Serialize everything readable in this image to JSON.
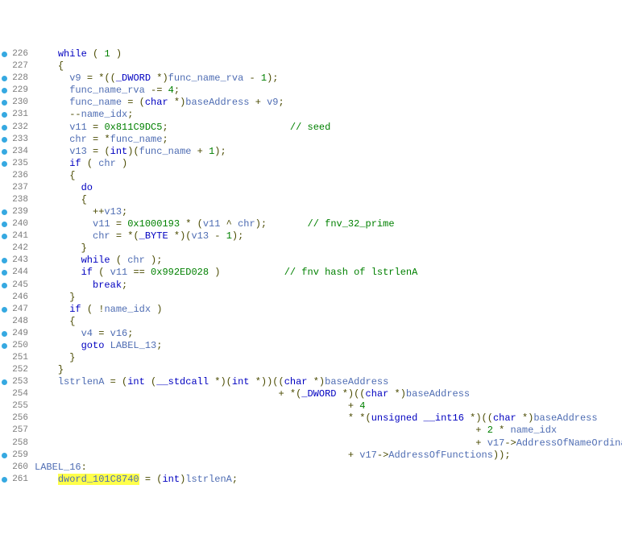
{
  "lines": [
    {
      "n": "226",
      "bp": true,
      "seg": [
        [
          "    ",
          0
        ],
        [
          "while",
          1
        ],
        [
          " ",
          0
        ],
        [
          "(",
          3
        ],
        [
          " ",
          0
        ],
        [
          "1",
          4
        ],
        [
          " ",
          0
        ],
        [
          ")",
          3
        ]
      ]
    },
    {
      "n": "227",
      "bp": false,
      "seg": [
        [
          "    ",
          0
        ],
        [
          "{",
          3
        ]
      ]
    },
    {
      "n": "228",
      "bp": true,
      "seg": [
        [
          "      ",
          0
        ],
        [
          "v9",
          2
        ],
        [
          " ",
          0
        ],
        [
          "=",
          3
        ],
        [
          " ",
          0
        ],
        [
          "*",
          3
        ],
        [
          "((",
          3
        ],
        [
          "_DWORD",
          1
        ],
        [
          " ",
          0
        ],
        [
          "*",
          3
        ],
        [
          ")",
          3
        ],
        [
          "func_name_rva",
          2
        ],
        [
          " ",
          0
        ],
        [
          "-",
          3
        ],
        [
          " ",
          0
        ],
        [
          "1",
          4
        ],
        [
          ");",
          3
        ]
      ]
    },
    {
      "n": "229",
      "bp": true,
      "seg": [
        [
          "      ",
          0
        ],
        [
          "func_name_rva",
          2
        ],
        [
          " ",
          0
        ],
        [
          "-=",
          3
        ],
        [
          " ",
          0
        ],
        [
          "4",
          4
        ],
        [
          ";",
          3
        ]
      ]
    },
    {
      "n": "230",
      "bp": true,
      "seg": [
        [
          "      ",
          0
        ],
        [
          "func_name",
          2
        ],
        [
          " ",
          0
        ],
        [
          "=",
          3
        ],
        [
          " ",
          0
        ],
        [
          "(",
          3
        ],
        [
          "char",
          1
        ],
        [
          " ",
          0
        ],
        [
          "*",
          3
        ],
        [
          ")",
          3
        ],
        [
          "baseAddress",
          2
        ],
        [
          " ",
          0
        ],
        [
          "+",
          3
        ],
        [
          " ",
          0
        ],
        [
          "v9",
          2
        ],
        [
          ";",
          3
        ]
      ]
    },
    {
      "n": "231",
      "bp": true,
      "seg": [
        [
          "      ",
          0
        ],
        [
          "--",
          3
        ],
        [
          "name_idx",
          2
        ],
        [
          ";",
          3
        ]
      ]
    },
    {
      "n": "232",
      "bp": true,
      "seg": [
        [
          "      ",
          0
        ],
        [
          "v11",
          2
        ],
        [
          " ",
          0
        ],
        [
          "=",
          3
        ],
        [
          " ",
          0
        ],
        [
          "0x811C9DC5",
          4
        ],
        [
          ";",
          3
        ],
        [
          "                     ",
          0
        ],
        [
          "// seed",
          5
        ]
      ]
    },
    {
      "n": "233",
      "bp": true,
      "seg": [
        [
          "      ",
          0
        ],
        [
          "chr",
          2
        ],
        [
          " ",
          0
        ],
        [
          "=",
          3
        ],
        [
          " ",
          0
        ],
        [
          "*",
          3
        ],
        [
          "func_name",
          2
        ],
        [
          ";",
          3
        ]
      ]
    },
    {
      "n": "234",
      "bp": true,
      "seg": [
        [
          "      ",
          0
        ],
        [
          "v13",
          2
        ],
        [
          " ",
          0
        ],
        [
          "=",
          3
        ],
        [
          " ",
          0
        ],
        [
          "(",
          3
        ],
        [
          "int",
          1
        ],
        [
          ")(",
          3
        ],
        [
          "func_name",
          2
        ],
        [
          " ",
          0
        ],
        [
          "+",
          3
        ],
        [
          " ",
          0
        ],
        [
          "1",
          4
        ],
        [
          ");",
          3
        ]
      ]
    },
    {
      "n": "235",
      "bp": true,
      "seg": [
        [
          "      ",
          0
        ],
        [
          "if",
          1
        ],
        [
          " ",
          0
        ],
        [
          "(",
          3
        ],
        [
          " ",
          0
        ],
        [
          "chr",
          2
        ],
        [
          " ",
          0
        ],
        [
          ")",
          3
        ]
      ]
    },
    {
      "n": "236",
      "bp": false,
      "seg": [
        [
          "      ",
          0
        ],
        [
          "{",
          3
        ]
      ]
    },
    {
      "n": "237",
      "bp": false,
      "seg": [
        [
          "        ",
          0
        ],
        [
          "do",
          1
        ]
      ]
    },
    {
      "n": "238",
      "bp": false,
      "seg": [
        [
          "        ",
          0
        ],
        [
          "{",
          3
        ]
      ]
    },
    {
      "n": "239",
      "bp": true,
      "seg": [
        [
          "          ",
          0
        ],
        [
          "++",
          3
        ],
        [
          "v13",
          2
        ],
        [
          ";",
          3
        ]
      ]
    },
    {
      "n": "240",
      "bp": true,
      "seg": [
        [
          "          ",
          0
        ],
        [
          "v11",
          2
        ],
        [
          " ",
          0
        ],
        [
          "=",
          3
        ],
        [
          " ",
          0
        ],
        [
          "0x1000193",
          4
        ],
        [
          " ",
          0
        ],
        [
          "*",
          3
        ],
        [
          " ",
          0
        ],
        [
          "(",
          3
        ],
        [
          "v11",
          2
        ],
        [
          " ",
          0
        ],
        [
          "^",
          3
        ],
        [
          " ",
          0
        ],
        [
          "chr",
          2
        ],
        [
          ");",
          3
        ],
        [
          "       ",
          0
        ],
        [
          "// fnv_32_prime",
          5
        ]
      ]
    },
    {
      "n": "241",
      "bp": true,
      "seg": [
        [
          "          ",
          0
        ],
        [
          "chr",
          2
        ],
        [
          " ",
          0
        ],
        [
          "=",
          3
        ],
        [
          " ",
          0
        ],
        [
          "*",
          3
        ],
        [
          "(",
          3
        ],
        [
          "_BYTE",
          1
        ],
        [
          " ",
          0
        ],
        [
          "*",
          3
        ],
        [
          ")(",
          3
        ],
        [
          "v13",
          2
        ],
        [
          " ",
          0
        ],
        [
          "-",
          3
        ],
        [
          " ",
          0
        ],
        [
          "1",
          4
        ],
        [
          ");",
          3
        ]
      ]
    },
    {
      "n": "242",
      "bp": false,
      "seg": [
        [
          "        ",
          0
        ],
        [
          "}",
          3
        ]
      ]
    },
    {
      "n": "243",
      "bp": true,
      "seg": [
        [
          "        ",
          0
        ],
        [
          "while",
          1
        ],
        [
          " ",
          0
        ],
        [
          "(",
          3
        ],
        [
          " ",
          0
        ],
        [
          "chr",
          2
        ],
        [
          " ",
          0
        ],
        [
          ");",
          3
        ]
      ]
    },
    {
      "n": "244",
      "bp": true,
      "seg": [
        [
          "        ",
          0
        ],
        [
          "if",
          1
        ],
        [
          " ",
          0
        ],
        [
          "(",
          3
        ],
        [
          " ",
          0
        ],
        [
          "v11",
          2
        ],
        [
          " ",
          0
        ],
        [
          "==",
          3
        ],
        [
          " ",
          0
        ],
        [
          "0x992ED028",
          4
        ],
        [
          " ",
          0
        ],
        [
          ")",
          3
        ],
        [
          "           ",
          0
        ],
        [
          "// fnv hash of lstrlenA",
          5
        ]
      ]
    },
    {
      "n": "245",
      "bp": true,
      "seg": [
        [
          "          ",
          0
        ],
        [
          "break",
          1
        ],
        [
          ";",
          3
        ]
      ]
    },
    {
      "n": "246",
      "bp": false,
      "seg": [
        [
          "      ",
          0
        ],
        [
          "}",
          3
        ]
      ]
    },
    {
      "n": "247",
      "bp": true,
      "seg": [
        [
          "      ",
          0
        ],
        [
          "if",
          1
        ],
        [
          " ",
          0
        ],
        [
          "(",
          3
        ],
        [
          " ",
          0
        ],
        [
          "!",
          3
        ],
        [
          "name_idx",
          2
        ],
        [
          " ",
          0
        ],
        [
          ")",
          3
        ]
      ]
    },
    {
      "n": "248",
      "bp": false,
      "seg": [
        [
          "      ",
          0
        ],
        [
          "{",
          3
        ]
      ]
    },
    {
      "n": "249",
      "bp": true,
      "seg": [
        [
          "        ",
          0
        ],
        [
          "v4",
          2
        ],
        [
          " ",
          0
        ],
        [
          "=",
          3
        ],
        [
          " ",
          0
        ],
        [
          "v16",
          2
        ],
        [
          ";",
          3
        ]
      ]
    },
    {
      "n": "250",
      "bp": true,
      "seg": [
        [
          "        ",
          0
        ],
        [
          "goto",
          1
        ],
        [
          " ",
          0
        ],
        [
          "LABEL_13",
          2
        ],
        [
          ";",
          3
        ]
      ]
    },
    {
      "n": "251",
      "bp": false,
      "seg": [
        [
          "      ",
          0
        ],
        [
          "}",
          3
        ]
      ]
    },
    {
      "n": "252",
      "bp": false,
      "seg": [
        [
          "    ",
          0
        ],
        [
          "}",
          3
        ]
      ]
    },
    {
      "n": "253",
      "bp": true,
      "seg": [
        [
          "    ",
          0
        ],
        [
          "lstrlenA",
          2
        ],
        [
          " ",
          0
        ],
        [
          "=",
          3
        ],
        [
          " ",
          0
        ],
        [
          "(",
          3
        ],
        [
          "int",
          1
        ],
        [
          " ",
          0
        ],
        [
          "(",
          3
        ],
        [
          "__stdcall",
          1
        ],
        [
          " ",
          0
        ],
        [
          "*",
          3
        ],
        [
          ")(",
          3
        ],
        [
          "int",
          1
        ],
        [
          " ",
          0
        ],
        [
          "*",
          3
        ],
        [
          "))((",
          3
        ],
        [
          "char",
          1
        ],
        [
          " ",
          0
        ],
        [
          "*",
          3
        ],
        [
          ")",
          3
        ],
        [
          "baseAddress",
          2
        ]
      ]
    },
    {
      "n": "254",
      "bp": false,
      "seg": [
        [
          "                                          ",
          0
        ],
        [
          "+",
          3
        ],
        [
          " ",
          0
        ],
        [
          "*",
          3
        ],
        [
          "(",
          3
        ],
        [
          "_DWORD",
          1
        ],
        [
          " ",
          0
        ],
        [
          "*",
          3
        ],
        [
          ")((",
          3
        ],
        [
          "char",
          1
        ],
        [
          " ",
          0
        ],
        [
          "*",
          3
        ],
        [
          ")",
          3
        ],
        [
          "baseAddress",
          2
        ]
      ]
    },
    {
      "n": "255",
      "bp": false,
      "seg": [
        [
          "                                                      ",
          0
        ],
        [
          "+",
          3
        ],
        [
          " ",
          0
        ],
        [
          "4",
          4
        ]
      ]
    },
    {
      "n": "256",
      "bp": false,
      "seg": [
        [
          "                                                      ",
          0
        ],
        [
          "*",
          3
        ],
        [
          " ",
          0
        ],
        [
          "*",
          3
        ],
        [
          "(",
          3
        ],
        [
          "unsigned",
          1
        ],
        [
          " ",
          0
        ],
        [
          "__int16",
          1
        ],
        [
          " ",
          0
        ],
        [
          "*",
          3
        ],
        [
          ")((",
          3
        ],
        [
          "char",
          1
        ],
        [
          " ",
          0
        ],
        [
          "*",
          3
        ],
        [
          ")",
          3
        ],
        [
          "baseAddress",
          2
        ]
      ]
    },
    {
      "n": "257",
      "bp": false,
      "seg": [
        [
          "                                                                            ",
          0
        ],
        [
          "+",
          3
        ],
        [
          " ",
          0
        ],
        [
          "2",
          4
        ],
        [
          " ",
          0
        ],
        [
          "*",
          3
        ],
        [
          " ",
          0
        ],
        [
          "name_idx",
          2
        ]
      ]
    },
    {
      "n": "258",
      "bp": false,
      "seg": [
        [
          "                                                                            ",
          0
        ],
        [
          "+",
          3
        ],
        [
          " ",
          0
        ],
        [
          "v17",
          2
        ],
        [
          "->",
          3
        ],
        [
          "AddressOfNameOrdinals",
          2
        ],
        [
          ")",
          3
        ]
      ]
    },
    {
      "n": "259",
      "bp": true,
      "seg": [
        [
          "                                                      ",
          0
        ],
        [
          "+",
          3
        ],
        [
          " ",
          0
        ],
        [
          "v17",
          2
        ],
        [
          "->",
          3
        ],
        [
          "AddressOfFunctions",
          2
        ],
        [
          "));",
          3
        ]
      ]
    },
    {
      "n": "260",
      "bp": false,
      "seg": [
        [
          "LABEL_16",
          2
        ],
        [
          ":",
          3
        ]
      ]
    },
    {
      "n": "261",
      "bp": true,
      "seg": [
        [
          "    ",
          0
        ],
        [
          "dword_101C8740",
          2,
          true
        ],
        [
          " ",
          0
        ],
        [
          "=",
          3
        ],
        [
          " ",
          0
        ],
        [
          "(",
          3
        ],
        [
          "int",
          1
        ],
        [
          ")",
          3
        ],
        [
          "lstrlenA",
          2
        ],
        [
          ";",
          3
        ]
      ]
    }
  ],
  "classes": [
    "plain",
    "kw",
    "id",
    "br",
    "num",
    "cmt"
  ]
}
